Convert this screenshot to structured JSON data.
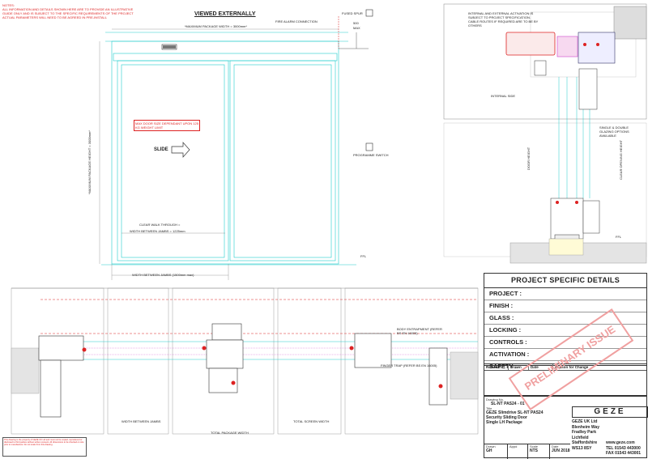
{
  "notes": {
    "heading": "NOTES:",
    "lines": [
      "ALL INFORMATION AND DETAILS SHOWN HERE ARE TO PROVIDE AN ILLUSTRATIVE",
      "GUIDE ONLY AND IS SUBJECT TO THE SPECIFIC REQUIREMENTS OF THE PROJECT",
      "ACTUAL PARAMETERS WILL NEED TO BE AGREED IN PRE-INSTALL"
    ]
  },
  "elevation": {
    "title": "VIEWED EXTERNALLY",
    "max_width": "*MAXIMUM PACKAGE WIDTH = 3000mm*",
    "max_height": "*MAXIMUM PACKAGE HEIGHT = 3000mm*",
    "weight_note": "MAX DOOR SIZE DEPENDANT UPON 125 KG WEIGHT LIMIT",
    "slide": "SLIDE",
    "clear_walk": "CLEAR WALK THROUGH =",
    "width_between_jambs": "WIDTH BETWEEN JAMBS = 1225mm",
    "width_between_jambs_bottom": "WIDTH BETWEEN JAMBS (1500mm max)",
    "ffl": "FFL",
    "fire_alarm": "FIRE ALARM CONNECTION",
    "fused_spur": "FUSED SPUR",
    "dim_500": "500",
    "max": "MAX",
    "programme_switch": "PROGRAMME SWITCH"
  },
  "section": {
    "activation_note": "INTERNAL AND EXTERNAL ACTIVATION IS SUBJECT TO PROJECT SPECIFICATION. CABLE ROUTES IF REQUIRED ARE TO BE BY OTHERS",
    "internal_side": "INTERNAL SIDE",
    "glazing_note": "SINGLE & DOUBLE GLAZING OPTIONS AVAILABLE",
    "door_height": "DOOR HEIGHT",
    "clear_opening_height": "CLEAR OPENING HEIGHT",
    "ffl": "FFL"
  },
  "plan": {
    "width_between_jambs": "WIDTH BETWEEN JAMBS",
    "total_package_width": "TOTAL PACKAGE WIDTH",
    "total_screen_width": "TOTAL SCREEN WIDTH",
    "body_entrapment": "BODY ENTRAPMENT (REFER BS EN 16005)",
    "finger_trap": "FINGER TRAP (REFER BS EN 16005)"
  },
  "details": {
    "heading": "PROJECT SPECIFIC DETAILS",
    "rows": [
      "PROJECT :",
      "FINISH :",
      "GLASS :",
      "LOCKING :",
      "CONTROLS :",
      "ACTIVATION :",
      "SAFETY :"
    ]
  },
  "revisions": {
    "cols": [
      "Revision",
      "Drawn",
      "Date",
      "Reason for Change"
    ]
  },
  "title_block": {
    "drawing_no_label": "Drawing No.",
    "drawing_no": "SL-NT PAS24 - 01",
    "title_label": "Title",
    "title_lines": [
      "GEZE Slimdrive SL-NT PAS24",
      "Security Sliding Door",
      "Single LH Package"
    ],
    "drawn_label": "Drawn",
    "drawn": "GH",
    "appd_label": "Appd",
    "appd": "",
    "scale_label": "Scale",
    "scale": "NTS",
    "date_label": "Date",
    "date": "JUN 2018",
    "company_lines": [
      "GEZE UK Ltd",
      "Blenheim Way",
      "Fradley Park",
      "Lichfield",
      "Staffordshire",
      "WS13 8SY"
    ],
    "web": "www.geze.com",
    "tel": "TEL 01543 443000",
    "fax": "FAX 01543 443001",
    "logo": "GEZE",
    "stamp": "PRELIMINARY ISSUE"
  },
  "disclaimer": "This drawing is the property of GEZE UK Ltd and must not be copied, reproduced or disclosed to third parties without written consent. All dimensions to be checked on site prior to manufacture. Do not scale from this drawing."
}
